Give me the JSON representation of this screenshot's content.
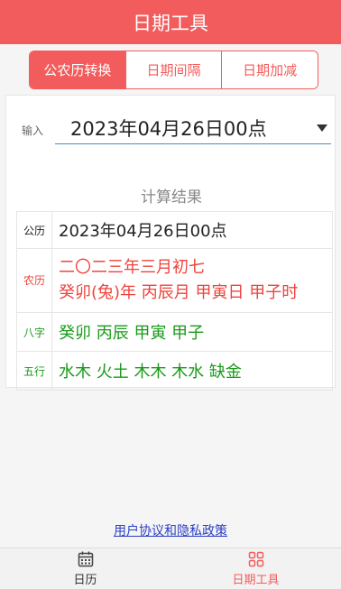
{
  "header": {
    "title": "日期工具"
  },
  "tabs": [
    {
      "label": "公农历转换",
      "active": true
    },
    {
      "label": "日期间隔",
      "active": false
    },
    {
      "label": "日期加减",
      "active": false
    }
  ],
  "input": {
    "label": "输入",
    "value": "2023年04月26日00点"
  },
  "result": {
    "title": "计算结果",
    "gregorian": {
      "label": "公历",
      "value": "2023年04月26日00点"
    },
    "lunar": {
      "label": "农历",
      "line1": "二〇二三年三月初七",
      "line2": "癸卯(兔)年 丙辰月 甲寅日 甲子时"
    },
    "bazi": {
      "label": "八字",
      "value": "癸卯 丙辰 甲寅 甲子"
    },
    "wuxing": {
      "label": "五行",
      "value": "水木 火土 木木 木水  缺金"
    }
  },
  "footer": {
    "privacy_link": "用户协议和隐私政策"
  },
  "bottom_nav": [
    {
      "label": "日历",
      "icon": "calendar-icon",
      "active": false
    },
    {
      "label": "日期工具",
      "icon": "grid-icon",
      "active": true
    }
  ],
  "colors": {
    "accent": "#f35c5c",
    "lunar_text": "#f0433c",
    "bazi_text": "#1a9a1a",
    "link": "#2b3fc4"
  }
}
